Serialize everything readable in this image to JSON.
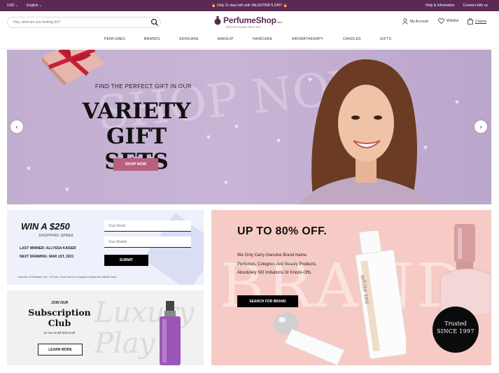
{
  "topbar": {
    "currency": "USD ⌄",
    "language": "English ⌄",
    "promo": "🔥 Only 11 days left until VALENTINE'S DAY! 🔥",
    "help": "Help & Information",
    "connect": "Connect with us"
  },
  "header": {
    "search_placeholder": "Hey, what are you looking for?",
    "logo_text": "PerfumeShop",
    "logo_suffix": ".com",
    "tagline": "TRUSTED ONLINE SINCE 1997",
    "account": "My Account",
    "wishlist": "Wishlist",
    "cart": "2 items"
  },
  "nav": [
    "PERFUMES",
    "BRANDS",
    "SKINCARE",
    "MAKEUP",
    "HAIRCARE",
    "AROMATHERAPY",
    "CANDLES",
    "GIFTS"
  ],
  "hero": {
    "bg_text": "SHOP NOW",
    "kicker": "FIND THE PERFECT GIFT IN OUR",
    "title_line1": "VARIETY",
    "title_line2": "GIFT SETS",
    "cta": "SHOP NOW",
    "prev": "‹",
    "next": "›"
  },
  "win": {
    "title": "WIN A $250",
    "subtitle": "SHOPPING SPREE",
    "last_winner": "LAST WINNER:  ALLYSSA KAISER",
    "next_drawing": "NEXT DRAWING:  MAR 1ST, 2021",
    "email_placeholder": "Your Email",
    "mobile_placeholder": "Your Mobile",
    "submit": "SUBMIT",
    "fine_print": "Must Be US Resident, 18+. To Enter: Click Here For Complete Details And Official Rules."
  },
  "subscription": {
    "bg_text": "Luxury Play",
    "join": "JOIN OUR",
    "title_line1": "Subscription",
    "title_line2": "Club",
    "price": "as low as $9.95/month",
    "cta": "LEARN MORE"
  },
  "sale": {
    "bg_text": "BRAND",
    "title": "UP TO 80% OFF.",
    "line1": "We Only Carry Genuine Brand Name",
    "line2": "Perfumes, Colognes And Beauty Products.",
    "line3": "Absolutely NO Imitations Or Knock-Offs.",
    "cta": "SEARCH FOR BRAND",
    "bottle_label": "white tea",
    "trusted": "Trusted",
    "since": "SINCE 1997"
  },
  "colors": {
    "topbar": "#5a2a55",
    "hero_bg": "#c2aed0",
    "cta_pink": "#b8607e",
    "sale_bg": "#f6cbc5",
    "win_bg": "#eef1fb"
  }
}
